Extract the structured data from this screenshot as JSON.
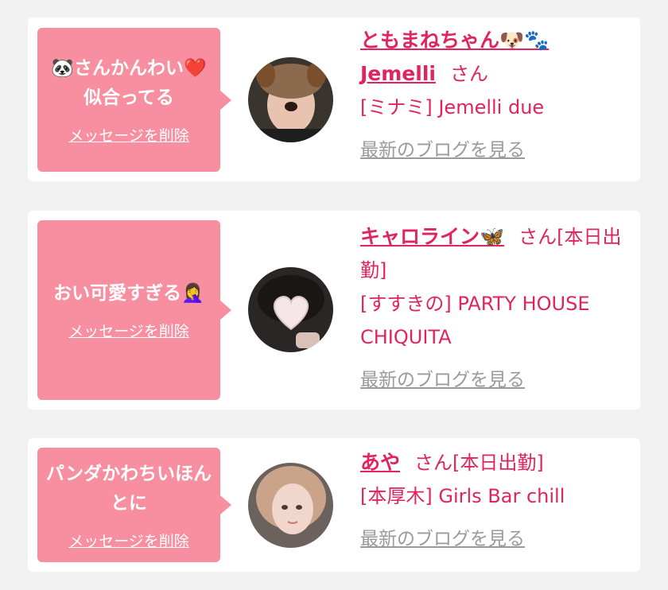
{
  "cards": [
    {
      "message": "🐼さんかんわい❤️似合ってる",
      "delete_label": "メッセージを削除",
      "name": "ともまねちゃん🐶🐾",
      "name2": "Jemelli",
      "honorific": "さん",
      "shop": "[ミナミ] Jemelli due",
      "blog_label": "最新のブログを見る"
    },
    {
      "message": "おい可愛すぎる🤦‍♀️",
      "delete_label": "メッセージを削除",
      "name": "キャロライン🦋",
      "honorific": "さん[本日出勤]",
      "shop": "[すすきの] PARTY HOUSE CHIQUITA",
      "blog_label": "最新のブログを見る"
    },
    {
      "message": "パンダかわちいほんとに",
      "delete_label": "メッセージを削除",
      "name": "あや",
      "honorific": "さん[本日出勤]",
      "shop": "[本厚木] Girls Bar chill",
      "blog_label": "最新のブログを見る"
    }
  ],
  "colors": {
    "bubble": "#f78fa0",
    "accent": "#e0245e",
    "muted": "#9a9a9a",
    "background": "#f2f2f2"
  }
}
